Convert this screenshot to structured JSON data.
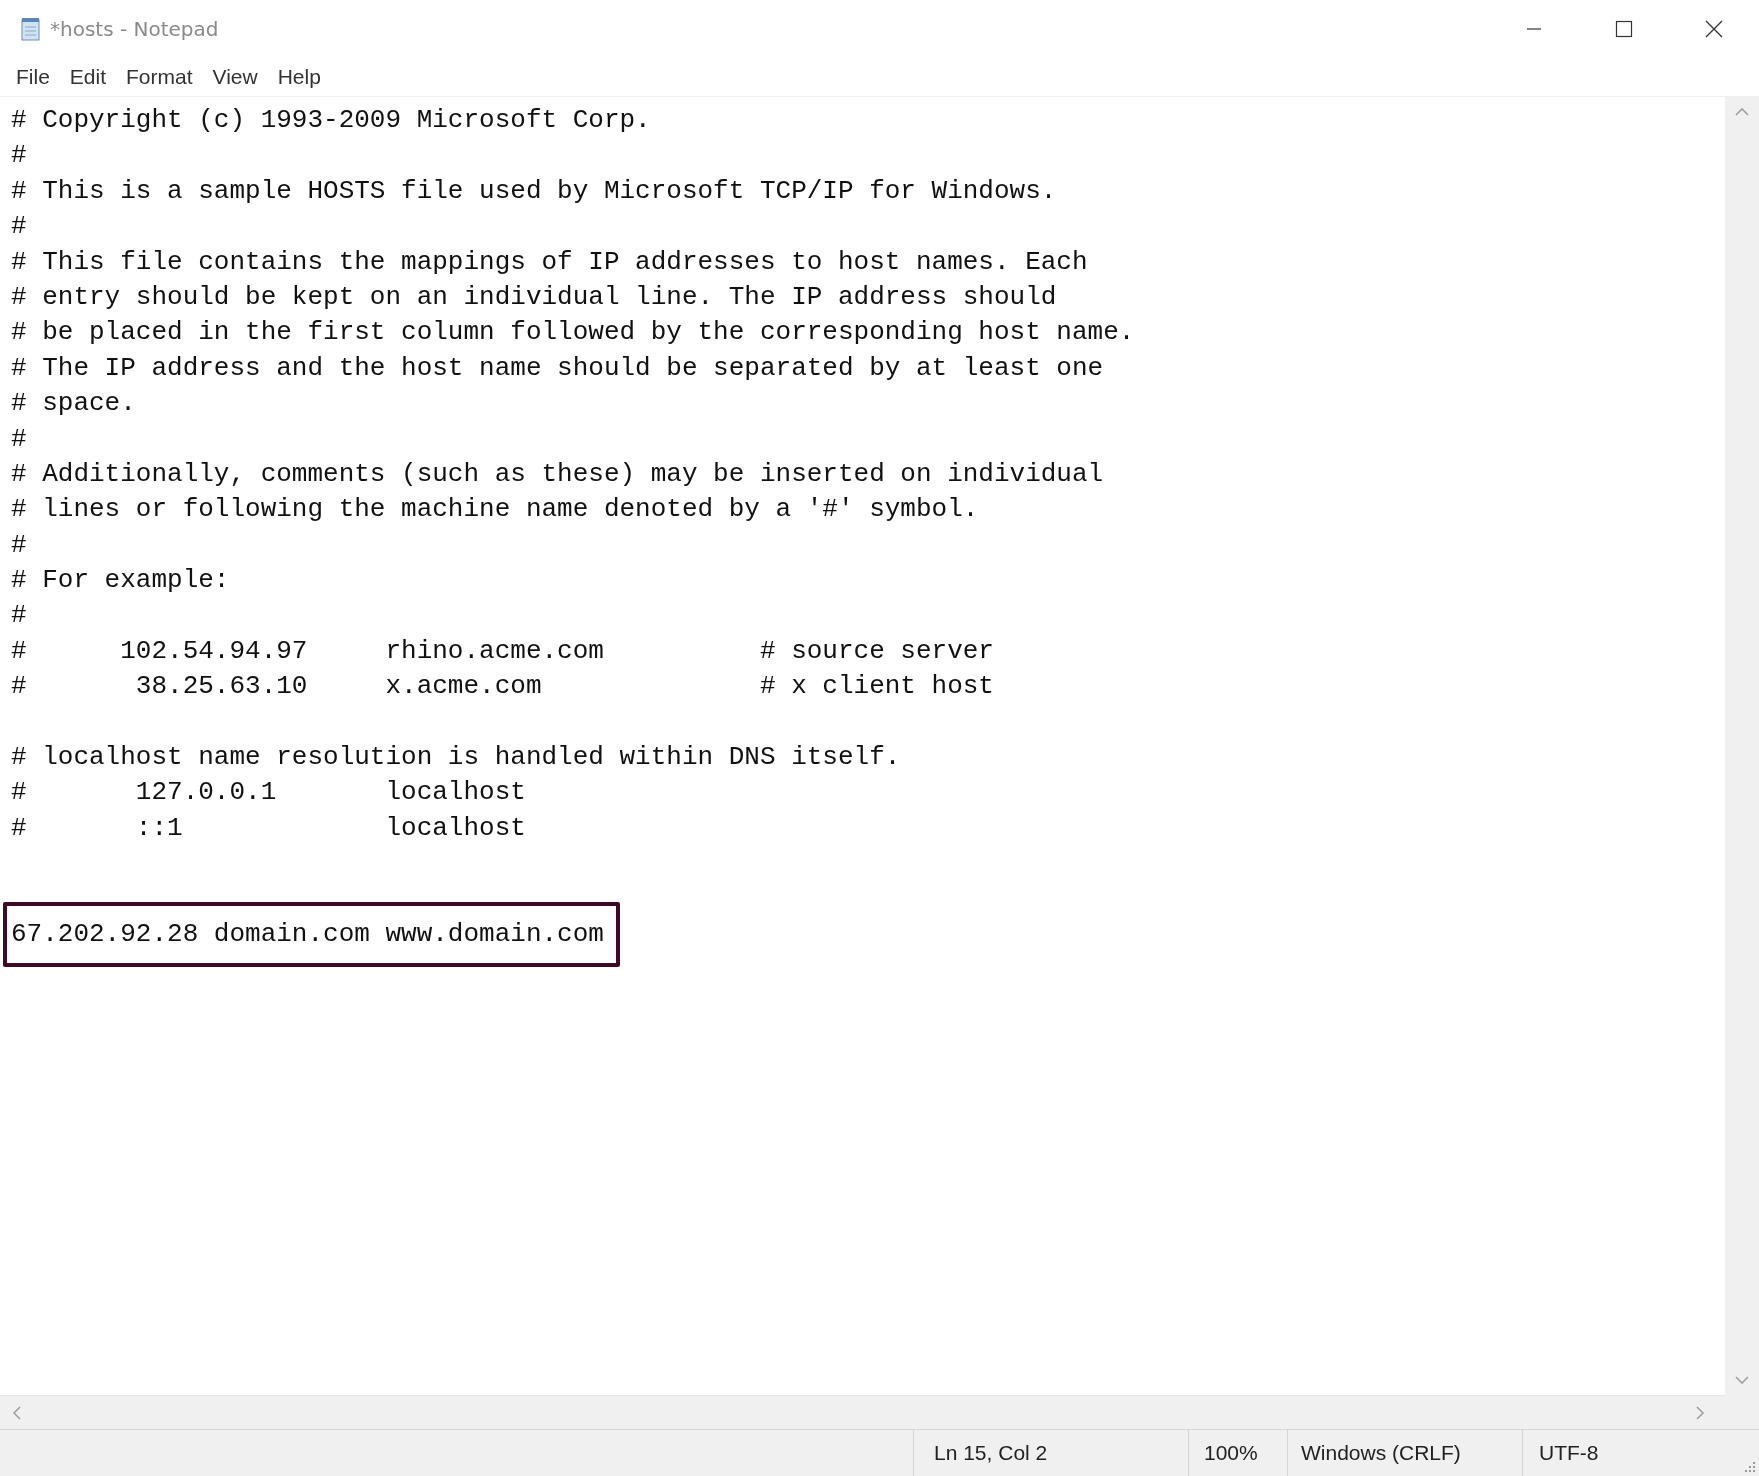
{
  "window": {
    "title": "*hosts - Notepad"
  },
  "menu": [
    "File",
    "Edit",
    "Format",
    "View",
    "Help"
  ],
  "editor": {
    "lines": [
      {
        "kind": "text",
        "text": "# Copyright (c) 1993-2009 Microsoft Corp."
      },
      {
        "kind": "text",
        "text": "#"
      },
      {
        "kind": "text",
        "text": "# This is a sample HOSTS file used by Microsoft TCP/IP for Windows."
      },
      {
        "kind": "text",
        "text": "#"
      },
      {
        "kind": "text",
        "text": "# This file contains the mappings of IP addresses to host names. Each"
      },
      {
        "kind": "text",
        "text": "# entry should be kept on an individual line. The IP address should"
      },
      {
        "kind": "text",
        "text": "# be placed in the first column followed by the corresponding host name."
      },
      {
        "kind": "text",
        "text": "# The IP address and the host name should be separated by at least one"
      },
      {
        "kind": "text",
        "text": "# space."
      },
      {
        "kind": "text",
        "text": "#"
      },
      {
        "kind": "text",
        "text": "# Additionally, comments (such as these) may be inserted on individual"
      },
      {
        "kind": "text",
        "text": "# lines or following the machine name denoted by a '#' symbol."
      },
      {
        "kind": "text",
        "text": "#"
      },
      {
        "kind": "text",
        "text": "# For example:"
      },
      {
        "kind": "text",
        "text": "#"
      },
      {
        "kind": "text",
        "text": "#      102.54.94.97     rhino.acme.com          # source server"
      },
      {
        "kind": "text",
        "text": "#       38.25.63.10     x.acme.com              # x client host"
      },
      {
        "kind": "blank"
      },
      {
        "kind": "text",
        "text": "# localhost name resolution is handled within DNS itself."
      },
      {
        "kind": "text",
        "text": "#       127.0.0.1       localhost"
      },
      {
        "kind": "text",
        "text": "#       ::1             localhost"
      },
      {
        "kind": "blank"
      },
      {
        "kind": "blank"
      },
      {
        "kind": "highlighted",
        "text": "67.202.92.28 domain.com www.domain.com"
      }
    ]
  },
  "status_bar": [
    "Ln 15, Col 2",
    "100%",
    "Windows (CRLF)",
    "UTF-8"
  ]
}
